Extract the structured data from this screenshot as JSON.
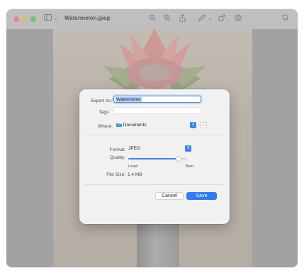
{
  "window": {
    "title": "Watermelon.jpeg",
    "title_chevron": "⌄"
  },
  "toolbar": {
    "sidebar_icon": "sidebar-icon",
    "zoom_out_icon": "zoom-out-icon",
    "zoom_in_icon": "zoom-in-icon",
    "share_icon": "share-icon",
    "markup_icon": "markup-icon",
    "rotate_icon": "rotate-icon",
    "annotate_icon": "annotate-icon",
    "search_icon": "search-icon"
  },
  "dialog": {
    "export_as_label": "Export As:",
    "export_as_value": "Watermelon",
    "tags_label": "Tags:",
    "tags_value": "",
    "where_label": "Where:",
    "where_value": "Documents",
    "format_label": "Format:",
    "format_value": "JPEG",
    "quality_label": "Quality:",
    "quality_value": 0.85,
    "quality_min_label": "Least",
    "quality_max_label": "Best",
    "file_size_label": "File Size:",
    "file_size_value": "1.4 MB",
    "cancel_label": "Cancel",
    "save_label": "Save"
  },
  "colors": {
    "accent": "#2f7cf6",
    "traffic_close": "#ff5f57",
    "traffic_minimize": "#febc2e",
    "traffic_zoom": "#28c840"
  }
}
